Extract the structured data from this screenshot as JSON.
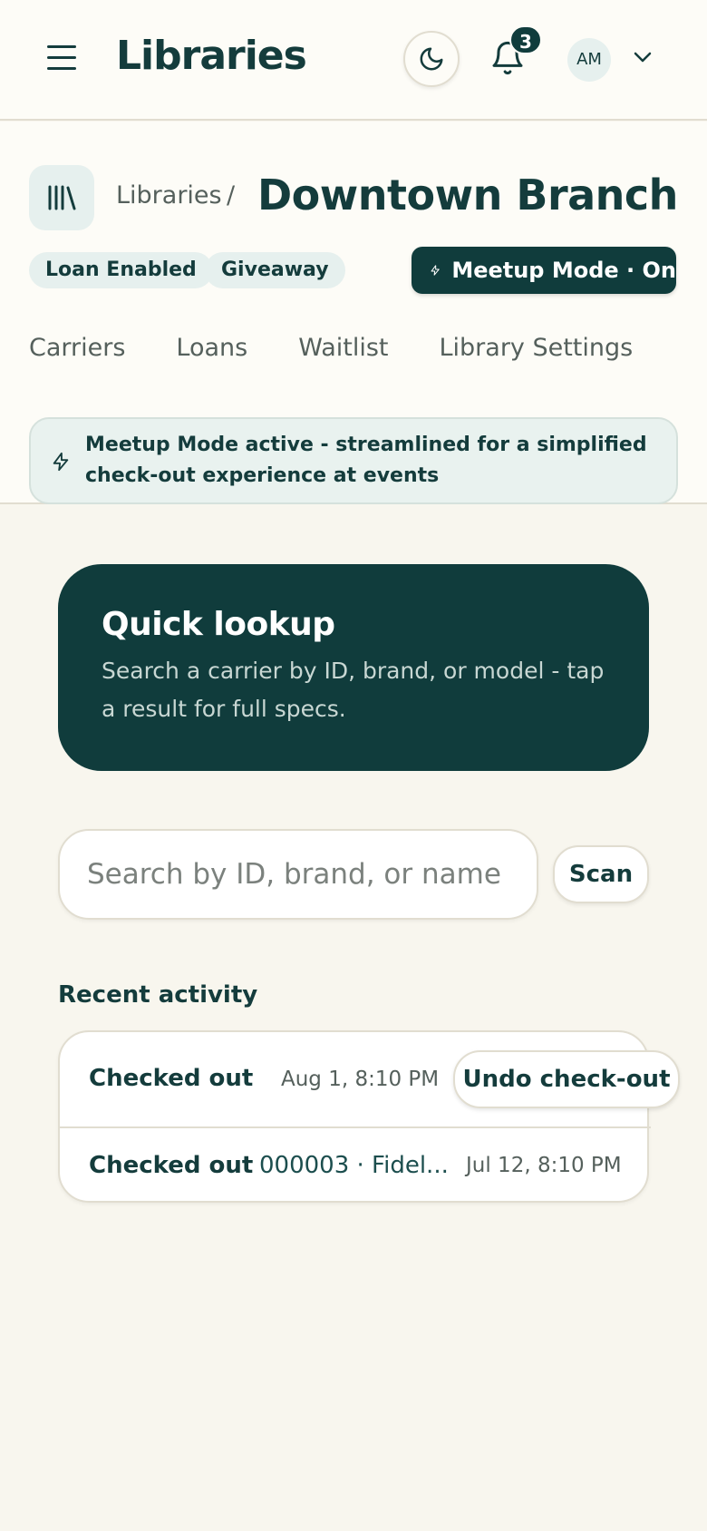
{
  "appbar": {
    "title": "Libraries",
    "notification_count": "3",
    "avatar_initials": "AM"
  },
  "header": {
    "breadcrumb_parent": "Libraries",
    "breadcrumb_separator": "/",
    "title": "Downtown Branch",
    "chips": [
      "Loan Enabled",
      "Giveaway"
    ],
    "meetup_button": "Meetup Mode · On",
    "tabs": [
      "Carriers",
      "Loans",
      "Waitlist",
      "Library Settings"
    ],
    "notice": "Meetup Mode active - streamlined for a simplified check-out experience at events"
  },
  "hero": {
    "title": "Quick lookup",
    "subtitle": "Search a carrier by ID, brand, or model - tap a result for full specs."
  },
  "search": {
    "placeholder": "Search by ID, brand, or name -",
    "scan_label": "Scan"
  },
  "activity": {
    "title": "Recent activity",
    "rows": [
      {
        "label": "Checked out",
        "item": "",
        "date": "Aug 1, 8:10 PM"
      },
      {
        "label": "Checked out",
        "item": "000003 · Fidel...",
        "date": "Jul 12, 8:10 PM"
      }
    ],
    "undo_label": "Undo check-out"
  },
  "colors": {
    "primary": "#103c3c",
    "background": "#f8f6ee",
    "surface": "#fdfcf7",
    "chip": "#e6f0ee"
  },
  "icons": [
    "menu-icon",
    "moon-icon",
    "bell-icon",
    "chevron-down-icon",
    "library-icon",
    "lightning-icon"
  ]
}
